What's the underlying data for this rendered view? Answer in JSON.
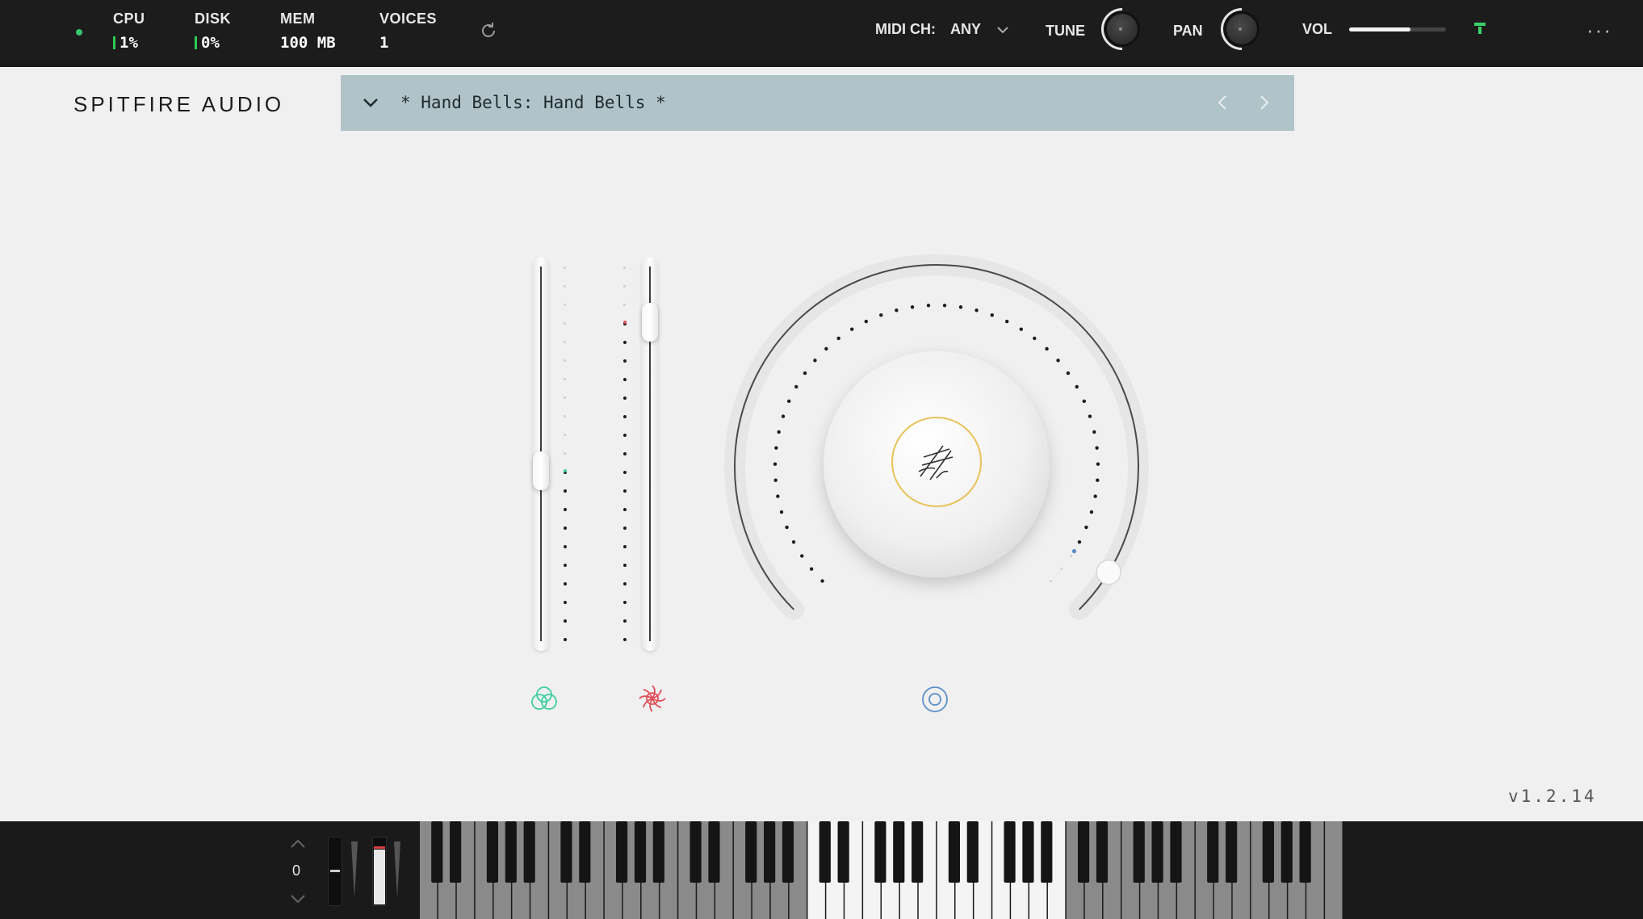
{
  "topbar": {
    "cpu": {
      "label": "CPU",
      "value": "1%"
    },
    "disk": {
      "label": "DISK",
      "value": "0%"
    },
    "mem": {
      "label": "MEM",
      "value": "100 MB"
    },
    "voices": {
      "label": "VOICES",
      "value": "1"
    },
    "midi_label": "MIDI CH:",
    "midi_value": "ANY",
    "tune_label": "TUNE",
    "pan_label": "PAN",
    "vol_label": "VOL",
    "vol_level": 0.63
  },
  "brand": "SPITFIRE AUDIO",
  "preset": {
    "name": "* Hand Bells: Hand Bells *"
  },
  "controls": {
    "modulation_level": 0.45,
    "expression_level": 0.85,
    "reverb_level": 0.95
  },
  "colors": {
    "accent_green": "#3ccf9a",
    "accent_red": "#e0505a",
    "accent_blue": "#5a8fc8",
    "accent_gold": "#e8c25a",
    "preset_bar": "#b0c3c9"
  },
  "keyboard": {
    "octave": "0"
  },
  "version": "v1.2.14"
}
